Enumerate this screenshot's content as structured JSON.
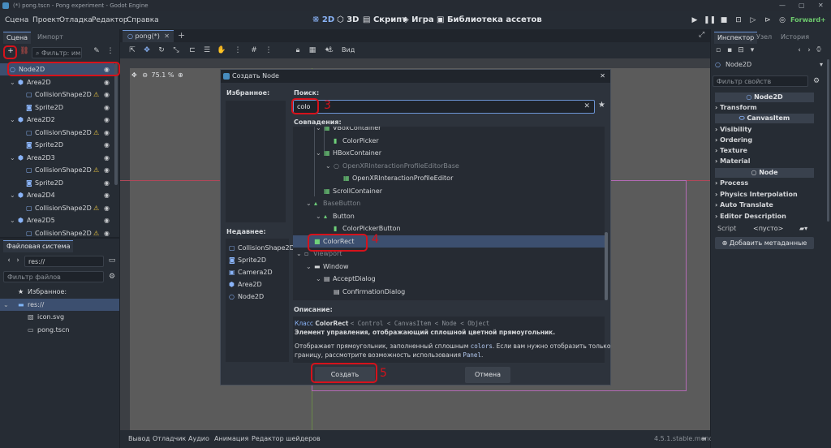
{
  "window": {
    "title": "(*) pong.tscn - Pong experiment - Godot Engine"
  },
  "menus": [
    "Сцена",
    "Проект",
    "Отладка",
    "Редактор",
    "Справка"
  ],
  "main_tabs": {
    "d2": "2D",
    "d3": "3D",
    "script": "Скрипт",
    "game": "Игра",
    "assetlib": "Библиотека ассетов"
  },
  "renderer": "Forward+",
  "scene_dock": {
    "tabs": [
      "Сцена",
      "Импорт"
    ],
    "filter_placeholder": "Фильтр: имя, t",
    "nodes": [
      {
        "label": "Node2D",
        "indent": 0,
        "icon": "node2d-icon",
        "warn": false,
        "fold": ""
      },
      {
        "label": "Area2D",
        "indent": 1,
        "icon": "area2d-icon",
        "warn": false,
        "fold": "v"
      },
      {
        "label": "CollisionShape2D",
        "indent": 2,
        "icon": "collisionshape2d-icon",
        "warn": true,
        "fold": ""
      },
      {
        "label": "Sprite2D",
        "indent": 2,
        "icon": "sprite2d-icon",
        "warn": false,
        "fold": ""
      },
      {
        "label": "Area2D2",
        "indent": 1,
        "icon": "area2d-icon",
        "warn": false,
        "fold": "v"
      },
      {
        "label": "CollisionShape2D",
        "indent": 2,
        "icon": "collisionshape2d-icon",
        "warn": true,
        "fold": ""
      },
      {
        "label": "Sprite2D",
        "indent": 2,
        "icon": "sprite2d-icon",
        "warn": false,
        "fold": ""
      },
      {
        "label": "Area2D3",
        "indent": 1,
        "icon": "area2d-icon",
        "warn": false,
        "fold": "v"
      },
      {
        "label": "CollisionShape2D",
        "indent": 2,
        "icon": "collisionshape2d-icon",
        "warn": true,
        "fold": ""
      },
      {
        "label": "Sprite2D",
        "indent": 2,
        "icon": "sprite2d-icon",
        "warn": false,
        "fold": ""
      },
      {
        "label": "Area2D4",
        "indent": 1,
        "icon": "area2d-icon",
        "warn": false,
        "fold": "v"
      },
      {
        "label": "CollisionShape2D",
        "indent": 2,
        "icon": "collisionshape2d-icon",
        "warn": true,
        "fold": ""
      },
      {
        "label": "Area2D5",
        "indent": 1,
        "icon": "area2d-icon",
        "warn": false,
        "fold": "v"
      },
      {
        "label": "CollisionShape2D",
        "indent": 2,
        "icon": "collisionshape2d-icon",
        "warn": true,
        "fold": ""
      }
    ]
  },
  "filesystem": {
    "tab": "Файловая система",
    "path": "res://",
    "filter_placeholder": "Фильтр файлов",
    "items": [
      {
        "label": "Избранное:",
        "indent": 0,
        "icon": "star-icon"
      },
      {
        "label": "res://",
        "indent": 0,
        "icon": "folder-icon"
      },
      {
        "label": "icon.svg",
        "indent": 1,
        "icon": "svg-file-icon"
      },
      {
        "label": "pong.tscn",
        "indent": 1,
        "icon": "scene-file-icon"
      }
    ]
  },
  "editor": {
    "scene_tab": "pong(*)",
    "toolbar_view": "Вид",
    "zoom": "75.1 %"
  },
  "dialog": {
    "title": "Создать Node",
    "favorites": "Избранное:",
    "recent": "Недавнее:",
    "recent_items": [
      {
        "label": "CollisionShape2D",
        "icon": "collisionshape2d-icon"
      },
      {
        "label": "Sprite2D",
        "icon": "sprite2d-icon"
      },
      {
        "label": "Camera2D",
        "icon": "camera2d-icon"
      },
      {
        "label": "Area2D",
        "icon": "area2d-icon"
      },
      {
        "label": "Node2D",
        "icon": "node2d-icon"
      }
    ],
    "search_label": "Поиск:",
    "search_value": "colo",
    "matches_label": "Совпадения:",
    "results": [
      {
        "label": "VBoxContainer",
        "indent": 2,
        "dim": false,
        "fold": "v"
      },
      {
        "label": "ColorPicker",
        "indent": 3,
        "dim": false,
        "fold": ""
      },
      {
        "label": "HBoxContainer",
        "indent": 2,
        "dim": false,
        "fold": "v"
      },
      {
        "label": "OpenXRInteractionProfileEditorBase",
        "indent": 3,
        "dim": true,
        "fold": "v"
      },
      {
        "label": "OpenXRInteractionProfileEditor",
        "indent": 4,
        "dim": false,
        "fold": ""
      },
      {
        "label": "ScrollContainer",
        "indent": 2,
        "dim": false,
        "fold": ""
      },
      {
        "label": "BaseButton",
        "indent": 1,
        "dim": true,
        "fold": "v"
      },
      {
        "label": "Button",
        "indent": 2,
        "dim": false,
        "fold": "v"
      },
      {
        "label": "ColorPickerButton",
        "indent": 3,
        "dim": false,
        "fold": ""
      },
      {
        "label": "ColorRect",
        "indent": 1,
        "dim": false,
        "fold": "",
        "selected": true
      },
      {
        "label": "Viewport",
        "indent": 0,
        "dim": true,
        "fold": "v"
      },
      {
        "label": "Window",
        "indent": 1,
        "dim": false,
        "fold": "v"
      },
      {
        "label": "AcceptDialog",
        "indent": 2,
        "dim": false,
        "fold": "v"
      },
      {
        "label": "ConfirmationDialog",
        "indent": 3,
        "dim": false,
        "fold": ""
      }
    ],
    "description_label": "Описание:",
    "class_prefix": "Класс",
    "class_name": "ColorRect",
    "inheritance": "< Control < CanvasItem < Node < Object",
    "desc_bold": "Элемент управления, отображающий сплошной цветной прямоугольник.",
    "desc_text_1": "Отображает прямоугольник, заполненный сплошным",
    "desc_code_1": "colors",
    "desc_text_2": ". Если вам нужно отобразить только",
    "desc_text_3": "границу, рассмотрите возможность использования",
    "desc_code_2": "Panel",
    "desc_text_4": ".",
    "create_button": "Создать",
    "cancel_button": "Отмена",
    "annotations": [
      "3",
      "4",
      "5"
    ]
  },
  "inspector": {
    "tabs": [
      "Инспектор",
      "Узел",
      "История"
    ],
    "object": "Node2D",
    "filter_placeholder": "Фильтр свойств",
    "node2d_header": "Node2D",
    "node2d_groups": [
      "Transform"
    ],
    "canvasitem_header": "CanvasItem",
    "canvasitem_groups": [
      "Visibility",
      "Ordering",
      "Texture",
      "Material"
    ],
    "node_header": "Node",
    "node_groups": [
      "Process",
      "Physics Interpolation",
      "Auto Translate",
      "Editor Description"
    ],
    "script_label": "Script",
    "script_value": "<пусто>",
    "add_metadata": "Добавить метаданные"
  },
  "bottom_tabs": [
    "Вывод",
    "Отладчик",
    "Аудио",
    "Анимация",
    "Редактор шейдеров"
  ],
  "version": "4.5.1.stable.mono",
  "colors": {
    "accent": "#8ab4f8",
    "highlight": "#d6121b",
    "selection": "#3c4f6f",
    "warning": "#e5c040"
  }
}
